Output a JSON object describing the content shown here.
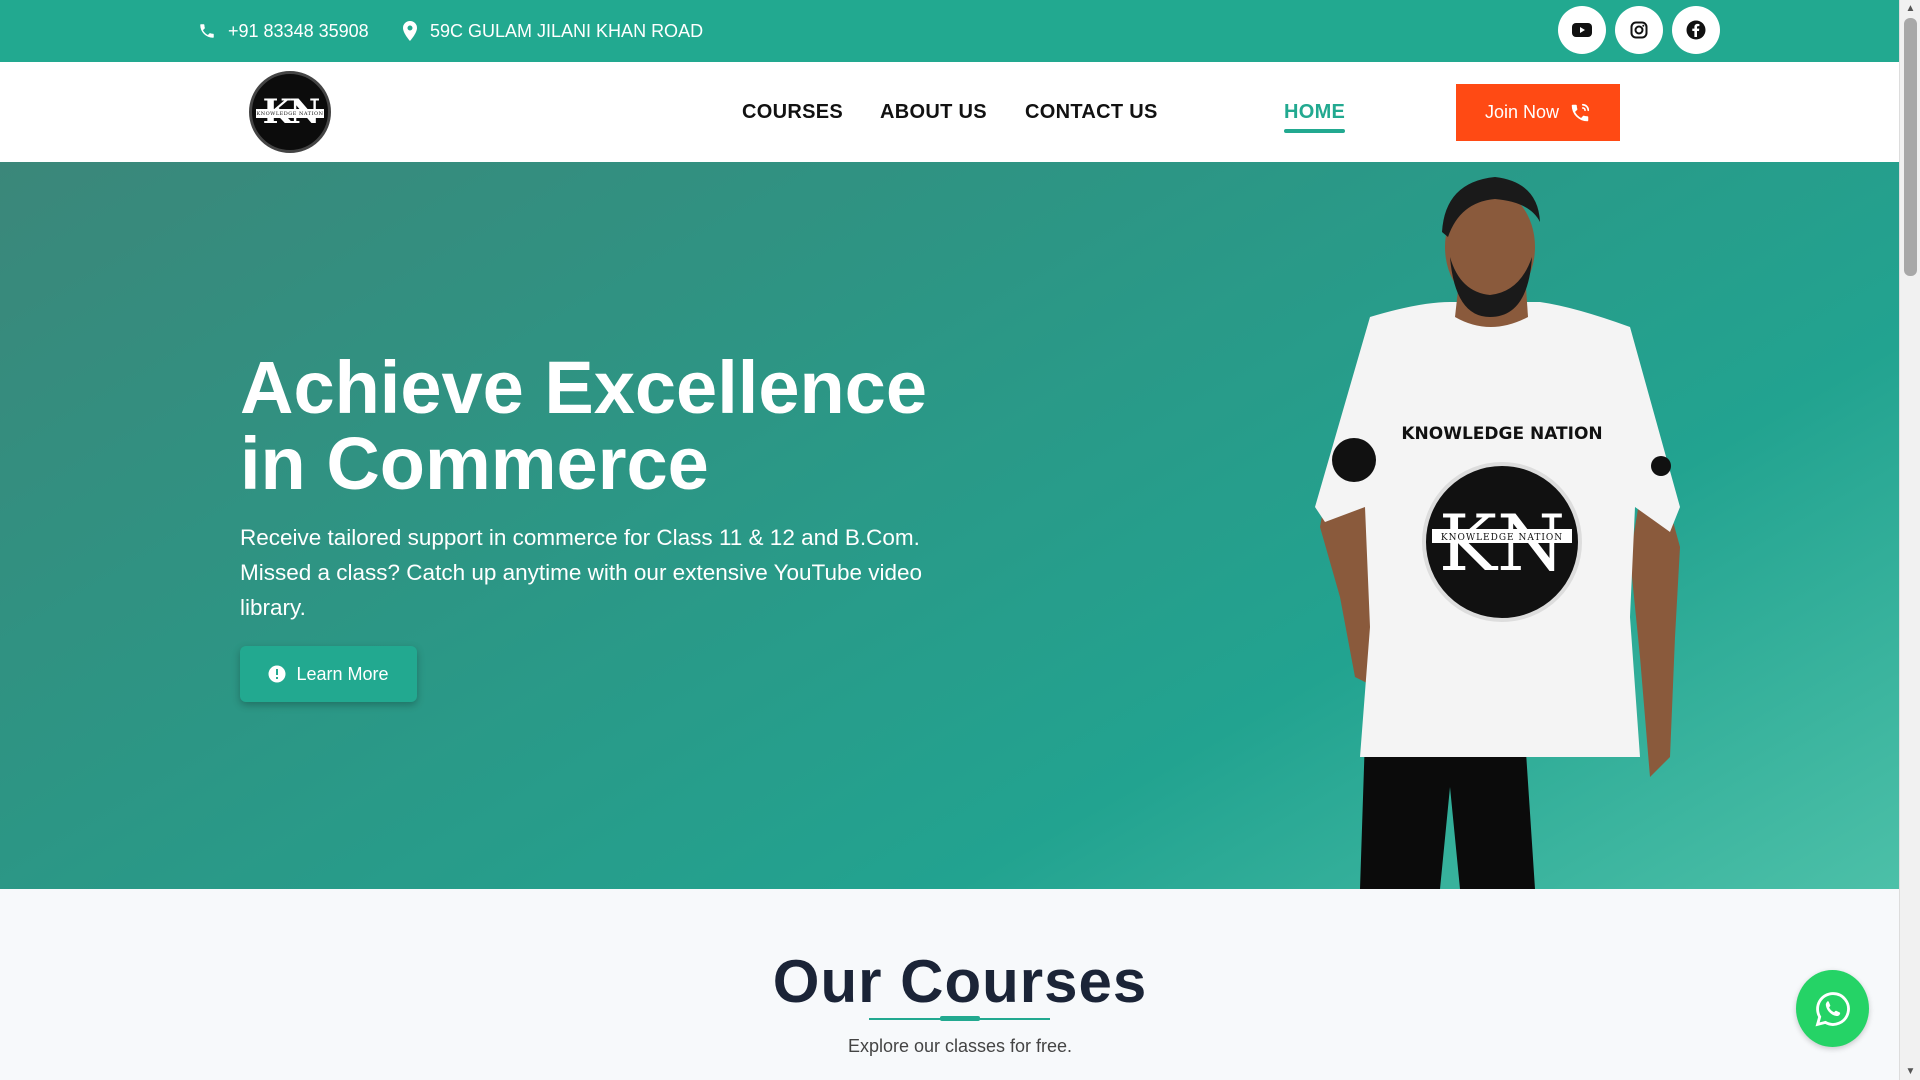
{
  "topbar": {
    "phone": "+91 83348 35908",
    "address": "59C GULAM JILANI KHAN ROAD",
    "social": [
      "youtube-icon",
      "instagram-icon",
      "facebook-icon"
    ]
  },
  "header": {
    "logo_text": "KN",
    "logo_subtext": "KNOWLEDGE NATION",
    "nav": [
      {
        "label": "HOME",
        "active": true
      },
      {
        "label": "COURSES"
      },
      {
        "label": "ABOUT US"
      },
      {
        "label": "CONTACT US"
      }
    ],
    "cta_label": "Join Now"
  },
  "hero": {
    "title": "Achieve Excellence in Commerce",
    "description": "Receive tailored support in commerce for Class 11 & 12 and B.Com. Missed a class? Catch up anytime with our extensive YouTube video library.",
    "button_label": "Learn More",
    "shirt_text": "KNOWLEDGE NATION"
  },
  "courses": {
    "heading": "Our Courses",
    "subheading": "Explore our classes for free."
  },
  "colors": {
    "primary": "#22a990",
    "cta": "#ff4a14",
    "whatsapp": "#25d366",
    "heading": "#1b2437"
  }
}
